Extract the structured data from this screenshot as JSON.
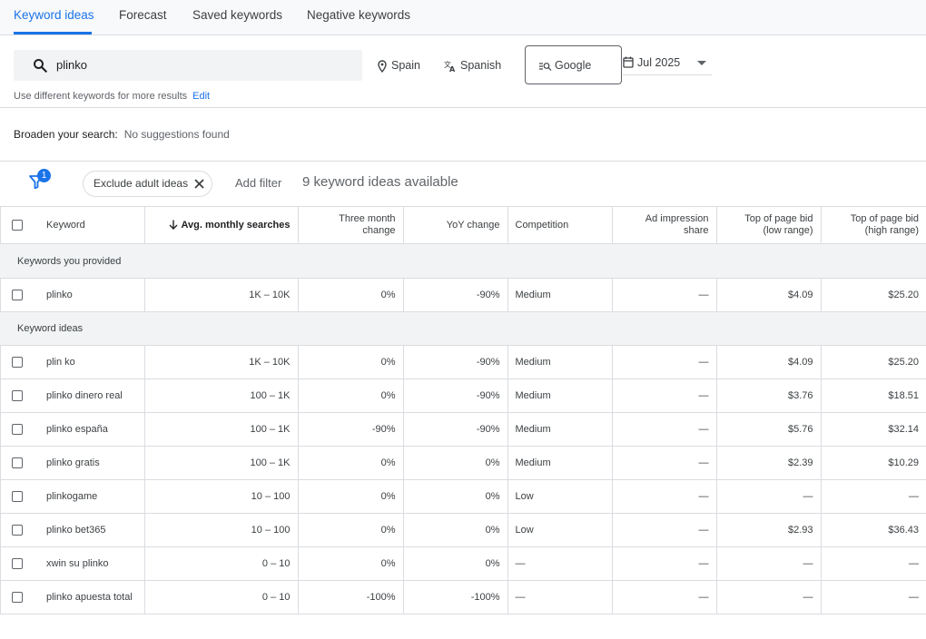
{
  "tabs": [
    {
      "label": "Keyword ideas",
      "active": true
    },
    {
      "label": "Forecast",
      "active": false
    },
    {
      "label": "Saved keywords",
      "active": false
    },
    {
      "label": "Negative keywords",
      "active": false
    }
  ],
  "search": {
    "value": "plinko",
    "icon": "search-icon"
  },
  "targeting": {
    "location": "Spain",
    "language": "Spanish",
    "network": "Google",
    "date_range": "Jul 2025"
  },
  "hint": {
    "text": "Use different keywords for more results",
    "edit_label": "Edit"
  },
  "broaden": {
    "label": "Broaden your search:",
    "value": "No suggestions found"
  },
  "filters": {
    "active_count": "1",
    "chip_label": "Exclude adult ideas",
    "add_filter_label": "Add filter",
    "ideas_count_text": "9 keyword ideas available"
  },
  "columns": {
    "keyword": "Keyword",
    "avg_monthly": "Avg. monthly searches",
    "three_month": "Three month change",
    "yoy": "YoY change",
    "competition": "Competition",
    "ad_impression": "Ad impression share",
    "bid_low": "Top of page bid (low range)",
    "bid_high": "Top of page bid (high range)"
  },
  "groups": {
    "provided_label": "Keywords you provided",
    "ideas_label": "Keyword ideas"
  },
  "provided_rows": [
    {
      "keyword": "plinko",
      "avg": "1K – 10K",
      "three": "0%",
      "yoy": "-90%",
      "comp": "Medium",
      "imp": "—",
      "low": "$4.09",
      "high": "$25.20"
    }
  ],
  "idea_rows": [
    {
      "keyword": "plin ko",
      "avg": "1K – 10K",
      "three": "0%",
      "yoy": "-90%",
      "comp": "Medium",
      "imp": "—",
      "low": "$4.09",
      "high": "$25.20"
    },
    {
      "keyword": "plinko dinero real",
      "avg": "100 – 1K",
      "three": "0%",
      "yoy": "-90%",
      "comp": "Medium",
      "imp": "—",
      "low": "$3.76",
      "high": "$18.51"
    },
    {
      "keyword": "plinko españa",
      "avg": "100 – 1K",
      "three": "-90%",
      "yoy": "-90%",
      "comp": "Medium",
      "imp": "—",
      "low": "$5.76",
      "high": "$32.14"
    },
    {
      "keyword": "plinko gratis",
      "avg": "100 – 1K",
      "three": "0%",
      "yoy": "0%",
      "comp": "Medium",
      "imp": "—",
      "low": "$2.39",
      "high": "$10.29"
    },
    {
      "keyword": "plinkogame",
      "avg": "10 – 100",
      "three": "0%",
      "yoy": "0%",
      "comp": "Low",
      "imp": "—",
      "low": "—",
      "high": "—"
    },
    {
      "keyword": "plinko bet365",
      "avg": "10 – 100",
      "three": "0%",
      "yoy": "0%",
      "comp": "Low",
      "imp": "—",
      "low": "$2.93",
      "high": "$36.43"
    },
    {
      "keyword": "xwin su plinko",
      "avg": "0 – 10",
      "three": "0%",
      "yoy": "0%",
      "comp": "—",
      "imp": "—",
      "low": "—",
      "high": "—"
    },
    {
      "keyword": "plinko apuesta total",
      "avg": "0 – 10",
      "three": "-100%",
      "yoy": "-100%",
      "comp": "—",
      "imp": "—",
      "low": "—",
      "high": "—"
    }
  ],
  "colors": {
    "accent": "#1a73e8",
    "border": "#dadce0",
    "group_bg": "#f1f3f4"
  }
}
